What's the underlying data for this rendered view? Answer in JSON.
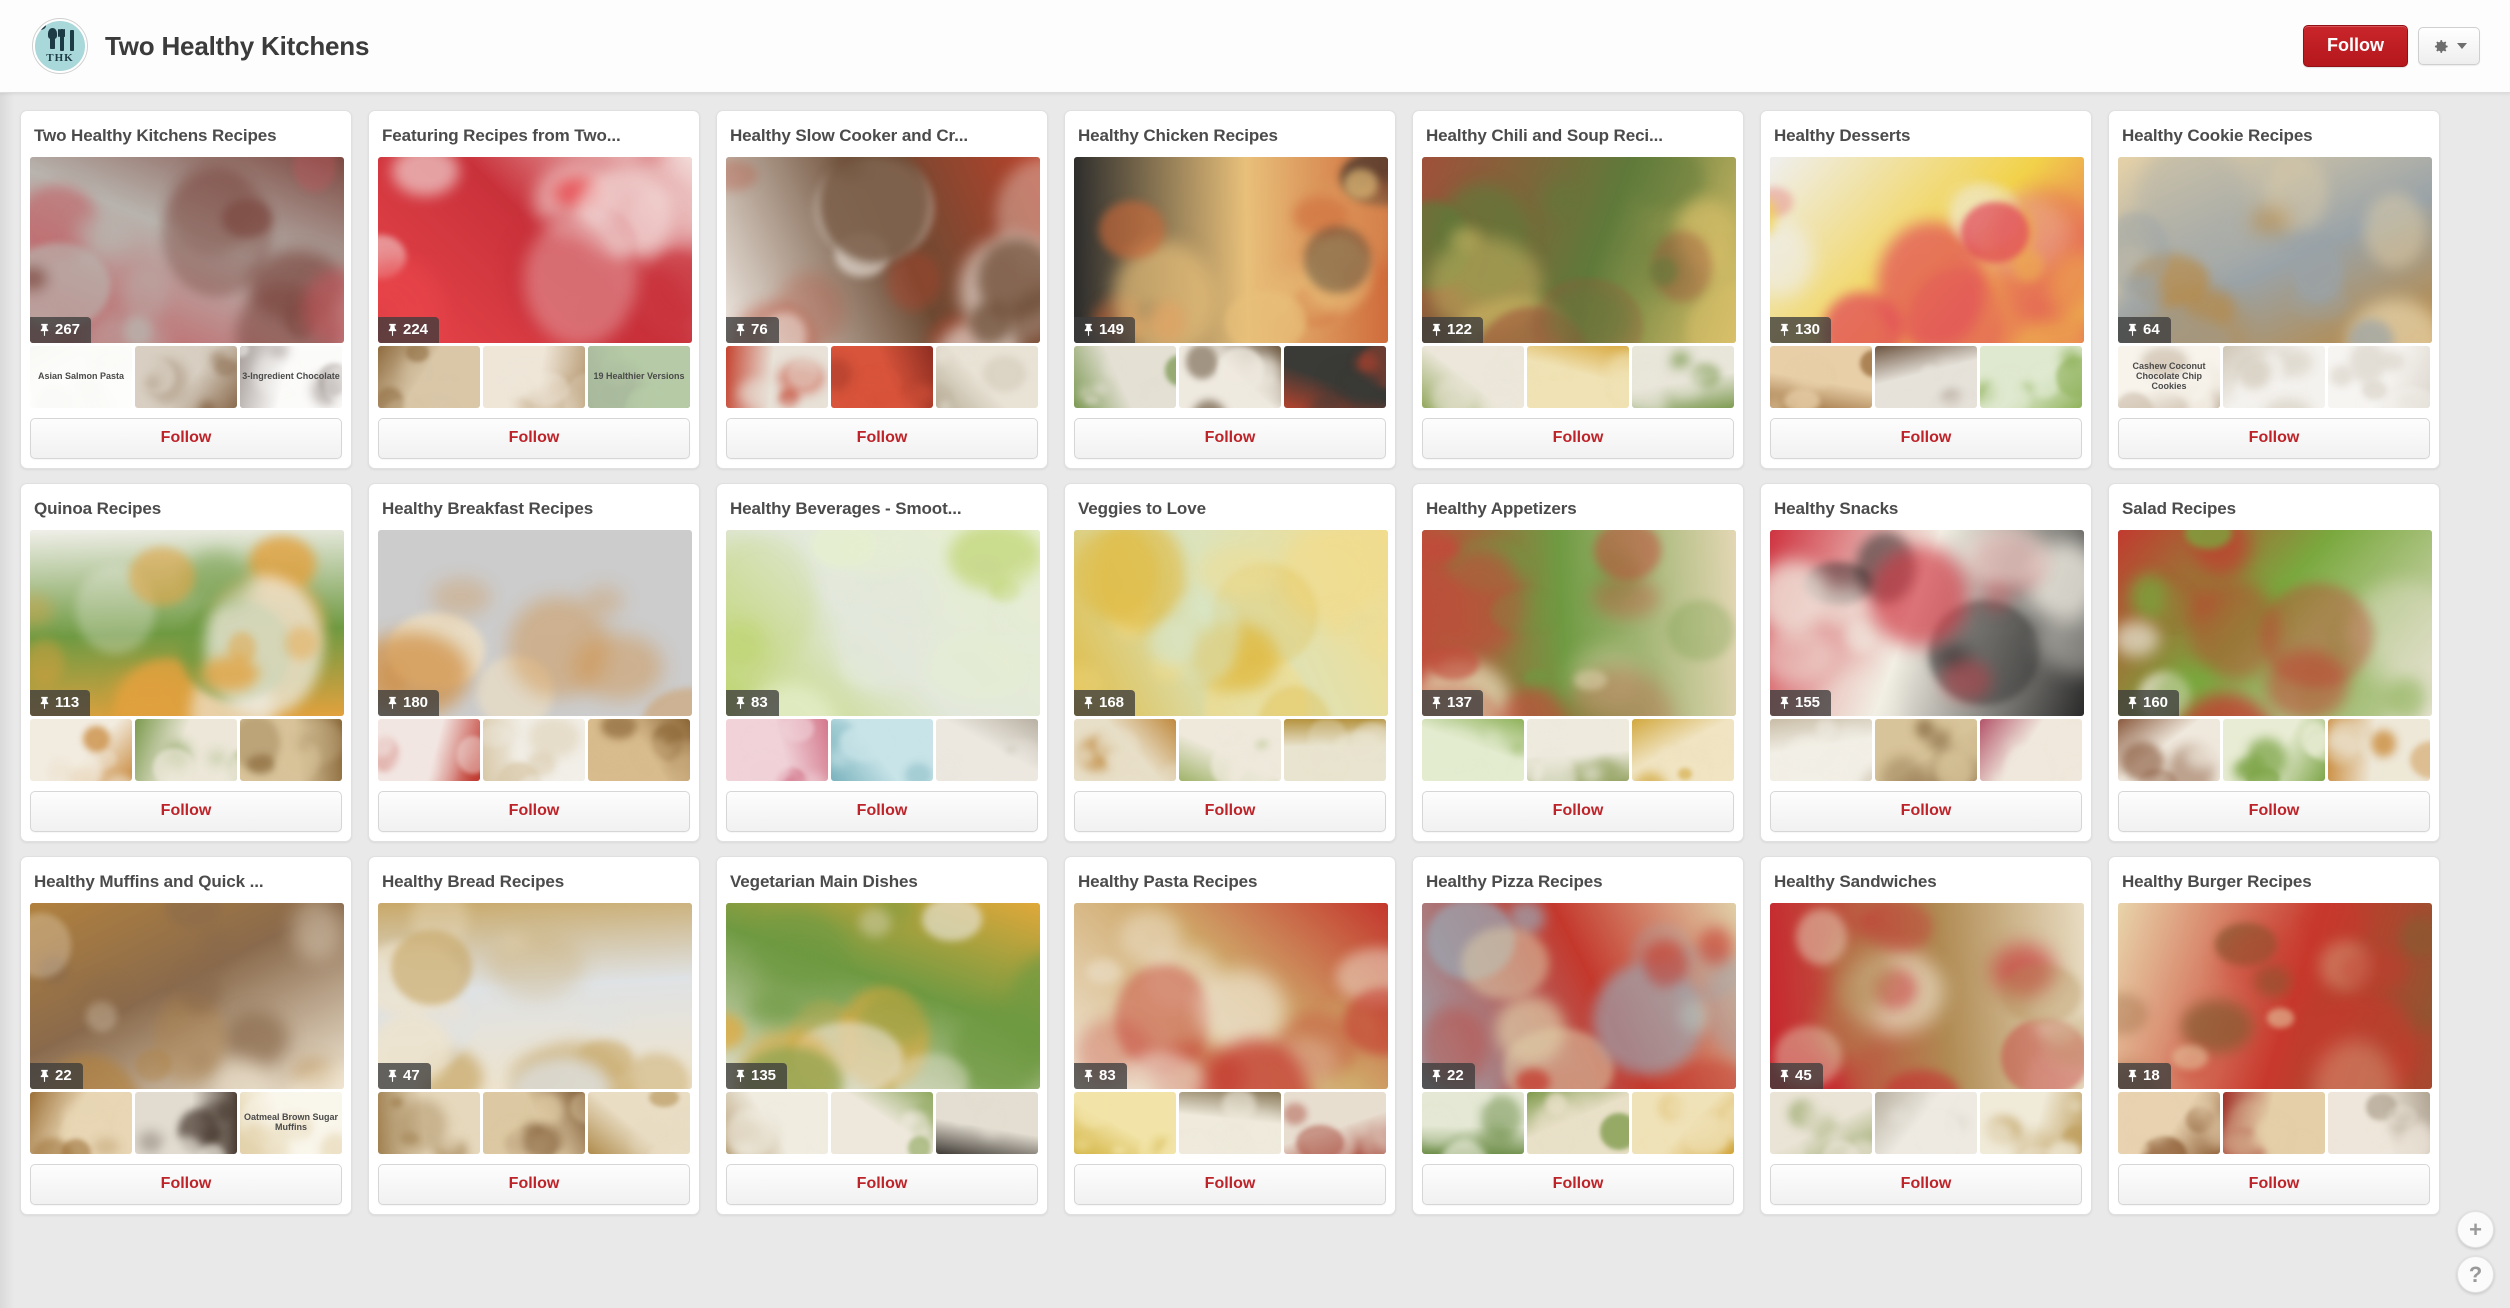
{
  "header": {
    "owner_name": "Two Healthy Kitchens",
    "avatar_initials": "THK",
    "follow_label": "Follow",
    "gear_icon": "gear-icon",
    "caret_icon": "chevron-down-icon",
    "accent_color": "#bd242a",
    "follow_button_color": "#c0232a",
    "avatar_color": "#a9d8da"
  },
  "floating_actions": [
    {
      "name": "add-pin-button",
      "glyph": "+"
    },
    {
      "name": "help-button",
      "glyph": "?"
    }
  ],
  "card_follow_label": "Follow",
  "pin_icon": "pin-icon",
  "boards": [
    {
      "title": "Two Healthy Kitchens Recipes",
      "pin_count": "267",
      "cover": {
        "c1": "#c2565c",
        "c2": "#7d4a42",
        "c3": "#b9b4ae",
        "style": "hearts"
      },
      "thumbs": [
        {
          "c1": "#fbfbf7",
          "c2": "#efefe9",
          "label": "Asian Salmon Pasta"
        },
        {
          "c1": "#d8cfc2",
          "c2": "#8a6a4c",
          "label": ""
        },
        {
          "c1": "#f7f5f1",
          "c2": "#3b2820",
          "label": "3-Ingredient Chocolate"
        }
      ]
    },
    {
      "title": "Featuring Recipes from Two...",
      "pin_count": "224",
      "cover": {
        "c1": "#e8454a",
        "c2": "#f2dcd9",
        "c3": "#c9313a",
        "style": "valentine"
      },
      "thumbs": [
        {
          "c1": "#d9c7a8",
          "c2": "#8e6b3f",
          "label": ""
        },
        {
          "c1": "#efe6d8",
          "c2": "#b79a73",
          "label": ""
        },
        {
          "c1": "#5e8b3c",
          "c2": "#3d6124",
          "label": "19 Healthier Versions"
        }
      ]
    },
    {
      "title": "Healthy Slow Cooker and Cr...",
      "pin_count": "76",
      "cover": {
        "c1": "#efe9e2",
        "c2": "#b8412a",
        "c3": "#6a4a33",
        "style": "stew"
      },
      "thumbs": [
        {
          "c1": "#e8e2d8",
          "c2": "#c5432f",
          "label": ""
        },
        {
          "c1": "#d8543b",
          "c2": "#8e2e22",
          "label": ""
        },
        {
          "c1": "#e9e3d6",
          "c2": "#b9ae98",
          "label": ""
        }
      ]
    },
    {
      "title": "Healthy Chicken Recipes",
      "pin_count": "149",
      "cover": {
        "c1": "#2b2b2b",
        "c2": "#cf6a3a",
        "c3": "#e8c07a",
        "style": "skillet"
      },
      "thumbs": [
        {
          "c1": "#e4e0d4",
          "c2": "#7d9a54",
          "label": ""
        },
        {
          "c1": "#efeae0",
          "c2": "#6f5b44",
          "label": ""
        },
        {
          "c1": "#3a3a36",
          "c2": "#b3432e",
          "label": ""
        }
      ]
    },
    {
      "title": "Healthy Chili and Soup Reci...",
      "pin_count": "122",
      "cover": {
        "c1": "#a0503a",
        "c2": "#d9c06a",
        "c3": "#5f7a3a",
        "style": "bowl"
      },
      "thumbs": [
        {
          "c1": "#ece7da",
          "c2": "#93a85e",
          "label": ""
        },
        {
          "c1": "#f0e2b4",
          "c2": "#d8a83e",
          "label": ""
        },
        {
          "c1": "#e9e6da",
          "c2": "#7e9b52",
          "label": ""
        }
      ]
    },
    {
      "title": "Healthy Desserts",
      "pin_count": "130",
      "cover": {
        "c1": "#efefef",
        "c2": "#e14a5a",
        "c3": "#f2d24a",
        "style": "rainbow"
      },
      "thumbs": [
        {
          "c1": "#e8cfa8",
          "c2": "#9c6f3e",
          "label": ""
        },
        {
          "c1": "#e6e2da",
          "c2": "#6d5440",
          "label": ""
        },
        {
          "c1": "#dfe9cf",
          "c2": "#8fb25a",
          "label": ""
        }
      ]
    },
    {
      "title": "Healthy Cookie Recipes",
      "pin_count": "64",
      "cover": {
        "c1": "#e6d2a8",
        "c2": "#b9873e",
        "c3": "#9aa3a8",
        "style": "cookies"
      },
      "thumbs": [
        {
          "c1": "#efe6d4",
          "c2": "#8a6a42",
          "label": "Cashew Coconut Chocolate Chip Cookies"
        },
        {
          "c1": "#f4f2ee",
          "c2": "#cfc6b6",
          "label": ""
        },
        {
          "c1": "#f7f5f2",
          "c2": "#dcd6cc",
          "label": ""
        }
      ]
    },
    {
      "title": "Quinoa Recipes",
      "pin_count": "113",
      "cover": {
        "c1": "#f0efe9",
        "c2": "#e2a13e",
        "c3": "#6f9a42",
        "style": "quinoa"
      },
      "thumbs": [
        {
          "c1": "#f2ece0",
          "c2": "#c98a3e",
          "label": ""
        },
        {
          "c1": "#ece7d8",
          "c2": "#7c9a4e",
          "label": ""
        },
        {
          "c1": "#d8c39a",
          "c2": "#8a6a3c",
          "label": ""
        }
      ]
    },
    {
      "title": "Healthy Breakfast Recipes",
      "pin_count": "180",
      "cover": {
        "c1": "#f4e3c2",
        "c2": "#d8a martin",
        "c3": "#cf8a3a",
        "style": "waffle"
      },
      "thumbs": [
        {
          "c1": "#f2e6e2",
          "c2": "#c0392f",
          "label": ""
        },
        {
          "c1": "#f2efe8",
          "c2": "#d8c8a8",
          "label": ""
        },
        {
          "c1": "#d8bc8e",
          "c2": "#8a6435",
          "label": ""
        }
      ]
    },
    {
      "title": "Healthy Beverages - Smoot...",
      "pin_count": "83",
      "cover": {
        "c1": "#e7f0cf",
        "c2": "#bcd36a",
        "c3": "#e3e8dc",
        "style": "smoothie"
      },
      "thumbs": [
        {
          "c1": "#f0d2d8",
          "c2": "#d4788c",
          "label": ""
        },
        {
          "c1": "#c8e4e8",
          "c2": "#7ab2bd",
          "label": ""
        },
        {
          "c1": "#ece8e0",
          "c2": "#b8b0a2",
          "label": ""
        }
      ]
    },
    {
      "title": "Veggies to Love",
      "pin_count": "168",
      "cover": {
        "c1": "#f2dc8c",
        "c2": "#e0bc46",
        "c3": "#d9e4c2",
        "style": "corn"
      },
      "thumbs": [
        {
          "c1": "#e8dfc8",
          "c2": "#c08a3e",
          "label": ""
        },
        {
          "c1": "#efe9dc",
          "c2": "#a0b46a",
          "label": ""
        },
        {
          "c1": "#e9e4cf",
          "c2": "#b5933e",
          "label": ""
        }
      ]
    },
    {
      "title": "Healthy Appetizers",
      "pin_count": "137",
      "cover": {
        "c1": "#e3d7b4",
        "c2": "#c24a3a",
        "c3": "#6f9a42",
        "style": "salsa"
      },
      "thumbs": [
        {
          "c1": "#e4ecd0",
          "c2": "#8fb25a",
          "label": ""
        },
        {
          "c1": "#eeeade",
          "c2": "#9aa86a",
          "label": ""
        },
        {
          "c1": "#f0e4c2",
          "c2": "#d2a83e",
          "label": ""
        }
      ]
    },
    {
      "title": "Healthy Snacks",
      "pin_count": "155",
      "cover": {
        "c1": "#2a2a2a",
        "c2": "#cf3340",
        "c3": "#f2efe4",
        "style": "fruitplate"
      },
      "thumbs": [
        {
          "c1": "#f2efe6",
          "c2": "#c8bca6",
          "label": ""
        },
        {
          "c1": "#d8c49a",
          "c2": "#7e5f38",
          "label": ""
        },
        {
          "c1": "#f0e8dc",
          "c2": "#b3546a",
          "label": ""
        }
      ]
    },
    {
      "title": "Salad Recipes",
      "pin_count": "160",
      "cover": {
        "c1": "#e9e4d4",
        "c2": "#c23a2f",
        "c3": "#7aa83e",
        "style": "salad"
      },
      "thumbs": [
        {
          "c1": "#efe8dc",
          "c2": "#8a5a3e",
          "label": ""
        },
        {
          "c1": "#e8ecd4",
          "c2": "#7fa64a",
          "label": ""
        },
        {
          "c1": "#eee8d8",
          "c2": "#c98a3a",
          "label": ""
        }
      ]
    },
    {
      "title": "Healthy Muffins and Quick ...",
      "pin_count": "22",
      "cover": {
        "c1": "#f0e6d2",
        "c2": "#b1813e",
        "c3": "#8a6a4c",
        "style": "muffin"
      },
      "thumbs": [
        {
          "c1": "#e8d6b4",
          "c2": "#9c7038",
          "label": ""
        },
        {
          "c1": "#e2dcd0",
          "c2": "#4a3c32",
          "label": ""
        },
        {
          "c1": "#f2ead2",
          "c2": "#c09a42",
          "label": "Oatmeal Brown Sugar Muffins"
        }
      ]
    },
    {
      "title": "Healthy Bread Recipes",
      "pin_count": "47",
      "cover": {
        "c1": "#efe4cc",
        "c2": "#c8a868",
        "c3": "#dfe2e4",
        "style": "flatbread"
      },
      "thumbs": [
        {
          "c1": "#e6d8bc",
          "c2": "#a08050",
          "label": ""
        },
        {
          "c1": "#dcc8a2",
          "c2": "#7e5a35",
          "label": ""
        },
        {
          "c1": "#e9ddc4",
          "c2": "#b08c4c",
          "label": ""
        }
      ]
    },
    {
      "title": "Vegetarian Main Dishes",
      "pin_count": "135",
      "cover": {
        "c1": "#e7e3d6",
        "c2": "#e0a83a",
        "c3": "#6f9a42",
        "style": "peppers"
      },
      "thumbs": [
        {
          "c1": "#f0ece0",
          "c2": "#b8a078",
          "label": ""
        },
        {
          "c1": "#eee8dc",
          "c2": "#8fa85e",
          "label": ""
        },
        {
          "c1": "#e4ded2",
          "c2": "#3f3a34",
          "label": ""
        }
      ]
    },
    {
      "title": "Healthy Pasta Recipes",
      "pin_count": "83",
      "cover": {
        "c1": "#f0e8d8",
        "c2": "#c4362c",
        "c3": "#cfa86a",
        "style": "pasta"
      },
      "thumbs": [
        {
          "c1": "#f2e4a8",
          "c2": "#d2b23e",
          "label": ""
        },
        {
          "c1": "#efeadc",
          "c2": "#8a7a5a",
          "label": ""
        },
        {
          "c1": "#e8ded0",
          "c2": "#a03a2c",
          "label": ""
        }
      ]
    },
    {
      "title": "Healthy Pizza Recipes",
      "pin_count": "22",
      "cover": {
        "c1": "#9aa8b4",
        "c2": "#e0cfa8",
        "c3": "#c4382c",
        "style": "pizza"
      },
      "thumbs": [
        {
          "c1": "#e4e8d4",
          "c2": "#6f8f4a",
          "label": ""
        },
        {
          "c1": "#e9e0c8",
          "c2": "#7e9a4a",
          "label": ""
        },
        {
          "c1": "#f0e2b8",
          "c2": "#d2a63a",
          "label": ""
        }
      ]
    },
    {
      "title": "Healthy Sandwiches",
      "pin_count": "45",
      "cover": {
        "c1": "#c8252e",
        "c2": "#e8dcc2",
        "c3": "#b08a52",
        "style": "sandwich"
      },
      "thumbs": [
        {
          "c1": "#eae4d6",
          "c2": "#9aa86a",
          "label": ""
        },
        {
          "c1": "#eeeae2",
          "c2": "#b8b0a0",
          "label": ""
        },
        {
          "c1": "#f0ead8",
          "c2": "#c0a060",
          "label": ""
        }
      ]
    },
    {
      "title": "Healthy Burger Recipes",
      "pin_count": "18",
      "cover": {
        "c1": "#e8d4aa",
        "c2": "#8a5a32",
        "c3": "#c8382c",
        "style": "burger"
      },
      "thumbs": [
        {
          "c1": "#e8d2b0",
          "c2": "#8a5a32",
          "label": ""
        },
        {
          "c1": "#e4cfa8",
          "c2": "#a03028",
          "label": ""
        },
        {
          "c1": "#eee6da",
          "c2": "#b0a492",
          "label": ""
        }
      ]
    }
  ]
}
